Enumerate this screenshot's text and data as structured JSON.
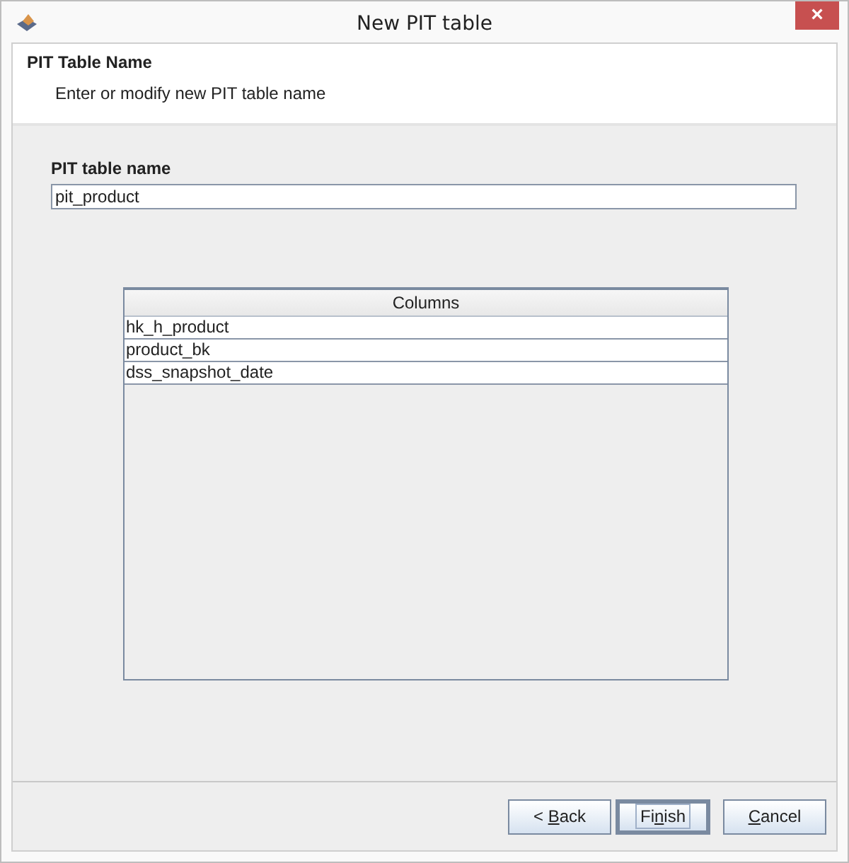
{
  "window": {
    "title": "New PIT table",
    "close": "×"
  },
  "header": {
    "title": "PIT Table Name",
    "subtitle": "Enter or modify new PIT table name"
  },
  "field": {
    "label": "PIT table name",
    "value": "pit_product"
  },
  "table": {
    "columns": [
      "Columns"
    ],
    "rows": [
      [
        "hk_h_product"
      ],
      [
        "product_bk"
      ],
      [
        "dss_snapshot_date"
      ]
    ]
  },
  "buttons": [
    {
      "before": "< ",
      "key": "B",
      "after": "ack",
      "focused": false
    },
    {
      "before": "Fi",
      "key": "n",
      "after": "ish",
      "focused": true
    },
    {
      "key": "C",
      "after": "ancel",
      "focused": false
    }
  ]
}
